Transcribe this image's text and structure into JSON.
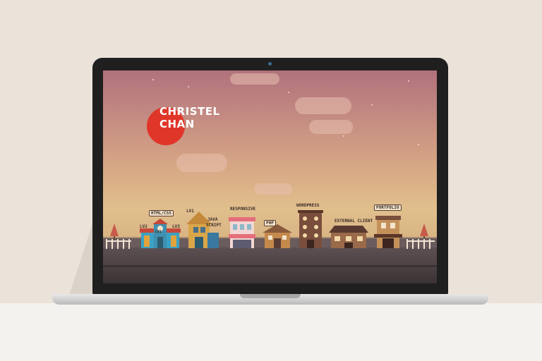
{
  "hero": {
    "logo_line1": "CHRISTEL",
    "logo_line2": "CHAN"
  },
  "houses": [
    {
      "sign": "HTML/CSS",
      "left_label": "LV2",
      "right_label": "LV3",
      "center_label": "LV1"
    },
    {
      "label_top": "LV1",
      "label_side": "JAVA",
      "label_side2": "SCRIPT"
    },
    {
      "label": "RESPONSIVE"
    },
    {
      "label": "PHP"
    },
    {
      "label": "WORDPRESS"
    },
    {
      "label": "EXTERNAL CLIENT"
    },
    {
      "sign": "PORTFOLIO"
    }
  ],
  "colors": {
    "sky_top": "#b0727c",
    "sky_bottom": "#e1bf8d",
    "logo_red": "#e0362a",
    "ground": "#4a3f41"
  }
}
